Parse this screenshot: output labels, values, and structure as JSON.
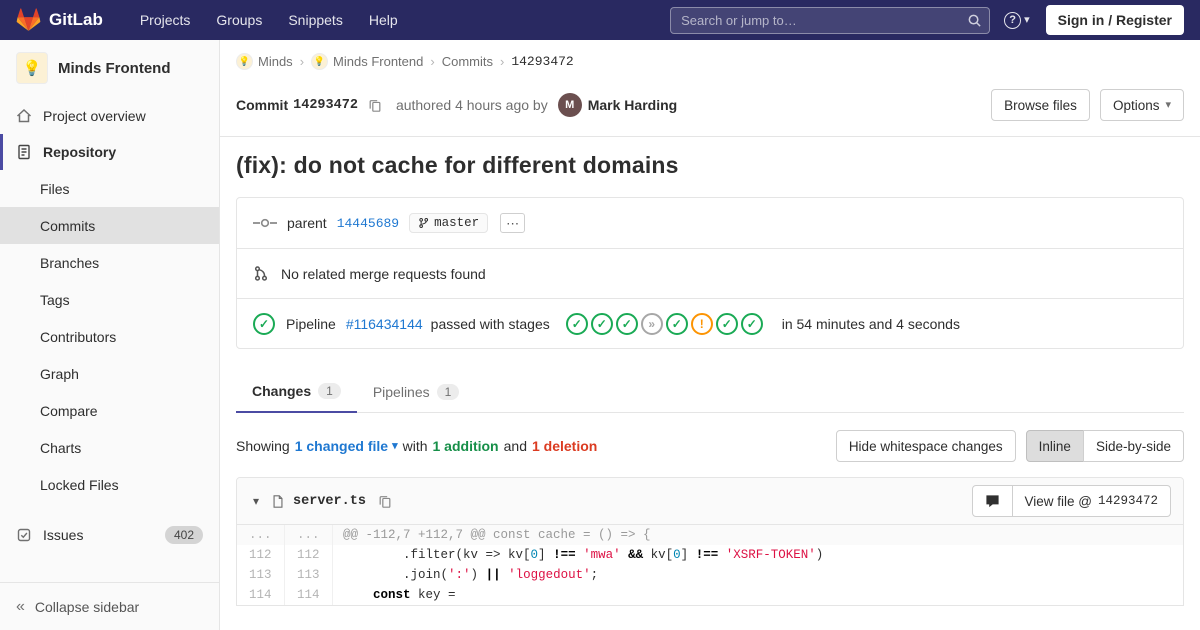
{
  "icons": {
    "caret_down": "▾",
    "collapse": "«",
    "ellipsis": "⋯",
    "crumb_separator": "›",
    "help": "?",
    "check": "✓",
    "skipped": "»",
    "warning": "!"
  },
  "colors": {
    "accent": "#4b4ba3",
    "link": "#1f78d1",
    "success": "#1aaa55",
    "warning": "#fc9403",
    "skipped": "#a7a7a7",
    "addition": "#168f48",
    "deletion": "#db3b21"
  },
  "navbar": {
    "brand": "GitLab",
    "items": [
      "Projects",
      "Groups",
      "Snippets",
      "Help"
    ],
    "search_placeholder": "Search or jump to…",
    "signin": "Sign in / Register"
  },
  "sidebar": {
    "project": {
      "name": "Minds Frontend",
      "avatar": "💡"
    },
    "overview": "Project overview",
    "repository": "Repository",
    "repo_items": [
      "Files",
      "Commits",
      "Branches",
      "Tags",
      "Contributors",
      "Graph",
      "Compare",
      "Charts",
      "Locked Files"
    ],
    "issues": {
      "label": "Issues",
      "count": "402"
    },
    "collapse": "Collapse sidebar"
  },
  "breadcrumb": {
    "items": [
      {
        "label": "Minds",
        "avatar": "💡"
      },
      {
        "label": "Minds Frontend",
        "avatar": "💡"
      },
      {
        "label": "Commits"
      },
      {
        "label": "14293472"
      }
    ]
  },
  "commit": {
    "label": "Commit",
    "sha": "14293472",
    "authored_text": "authored 4 hours ago by",
    "author": "Mark Harding",
    "author_initial": "M",
    "browse_files": "Browse files",
    "options": "Options",
    "title": "(fix): do not cache for different domains",
    "parent_label": "parent",
    "parent_sha": "14445689",
    "branch": "master",
    "related_mr": "No related merge requests found",
    "pipeline": {
      "label": "Pipeline",
      "id": "#116434144",
      "status_text": "passed with stages",
      "stages": [
        "success",
        "success",
        "success",
        "skipped",
        "success",
        "warning",
        "success",
        "success"
      ],
      "duration_text": "in 54 minutes and 4 seconds"
    }
  },
  "tabs": [
    {
      "label": "Changes",
      "count": "1"
    },
    {
      "label": "Pipelines",
      "count": "1"
    }
  ],
  "diff_summary": {
    "showing": "Showing",
    "changed_file": "1 changed file",
    "with": "with",
    "addition": "1 addition",
    "and": "and",
    "deletion": "1 deletion",
    "hide_whitespace": "Hide whitespace changes",
    "inline": "Inline",
    "side_by_side": "Side-by-side"
  },
  "file_diff": {
    "filename": "server.ts",
    "view_file_label": "View file @",
    "view_file_sha": "14293472",
    "lines": [
      {
        "type": "match",
        "old": "...",
        "new": "...",
        "tokens": [
          {
            "t": "@@ -112,7 +112,7 @@ const cache = () => {",
            "c": ""
          }
        ]
      },
      {
        "type": "context",
        "old": "112",
        "new": "112",
        "tokens": [
          {
            "t": "        .filter(kv => kv[",
            "c": ""
          },
          {
            "t": "0",
            "c": "num"
          },
          {
            "t": "] ",
            "c": ""
          },
          {
            "t": "!==",
            "c": "op"
          },
          {
            "t": " ",
            "c": ""
          },
          {
            "t": "'mwa'",
            "c": "str"
          },
          {
            "t": " ",
            "c": ""
          },
          {
            "t": "&&",
            "c": "op"
          },
          {
            "t": " kv[",
            "c": ""
          },
          {
            "t": "0",
            "c": "num"
          },
          {
            "t": "] ",
            "c": ""
          },
          {
            "t": "!==",
            "c": "op"
          },
          {
            "t": " ",
            "c": ""
          },
          {
            "t": "'XSRF-TOKEN'",
            "c": "str"
          },
          {
            "t": ")",
            "c": ""
          }
        ]
      },
      {
        "type": "context",
        "old": "113",
        "new": "113",
        "tokens": [
          {
            "t": "        .join(",
            "c": ""
          },
          {
            "t": "':'",
            "c": "str"
          },
          {
            "t": ") ",
            "c": ""
          },
          {
            "t": "||",
            "c": "op"
          },
          {
            "t": " ",
            "c": ""
          },
          {
            "t": "'loggedout'",
            "c": "str"
          },
          {
            "t": ";",
            "c": ""
          }
        ]
      },
      {
        "type": "context",
        "old": "114",
        "new": "114",
        "tokens": [
          {
            "t": "    ",
            "c": ""
          },
          {
            "t": "const",
            "c": "kw"
          },
          {
            "t": " key =",
            "c": ""
          }
        ]
      }
    ]
  }
}
